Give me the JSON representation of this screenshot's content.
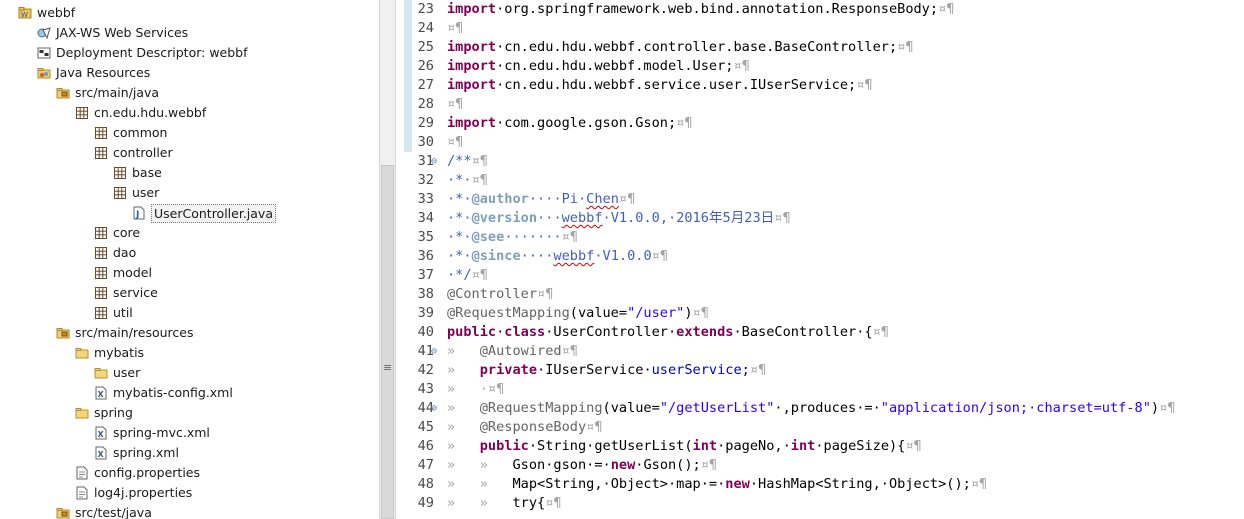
{
  "explorer": {
    "rows": [
      {
        "label": "webbf",
        "icon": "project-icon",
        "arrow": "▲"
      },
      {
        "label": "JAX-WS Web Services",
        "icon": "web-services-icon",
        "arrow": "▷"
      },
      {
        "label": "Deployment Descriptor: webbf",
        "icon": "descriptor-icon",
        "arrow": "▷"
      },
      {
        "label": "Java Resources",
        "icon": "java-resources-icon",
        "arrow": "▲"
      },
      {
        "label": "src/main/java",
        "icon": "source-folder-icon",
        "arrow": "▲"
      },
      {
        "label": "cn.edu.hdu.webbf",
        "icon": "package-icon",
        "arrow": "▲"
      },
      {
        "label": "common",
        "icon": "package-icon",
        "arrow": "▷"
      },
      {
        "label": "controller",
        "icon": "package-icon",
        "arrow": "▲"
      },
      {
        "label": "base",
        "icon": "package-icon",
        "arrow": "▷"
      },
      {
        "label": "user",
        "icon": "package-icon",
        "arrow": "▲"
      },
      {
        "label": "UserController.java",
        "icon": "java-file-icon",
        "arrow": "▷"
      },
      {
        "label": "core",
        "icon": "package-icon",
        "arrow": "▷"
      },
      {
        "label": "dao",
        "icon": "package-icon",
        "arrow": "▷"
      },
      {
        "label": "model",
        "icon": "package-icon",
        "arrow": "▷"
      },
      {
        "label": "service",
        "icon": "package-icon",
        "arrow": "▷"
      },
      {
        "label": "util",
        "icon": "package-icon",
        "arrow": ""
      },
      {
        "label": "src/main/resources",
        "icon": "source-folder-icon",
        "arrow": "▲"
      },
      {
        "label": "mybatis",
        "icon": "folder-icon",
        "arrow": "▲"
      },
      {
        "label": "user",
        "icon": "folder-icon",
        "arrow": "▷"
      },
      {
        "label": "mybatis-config.xml",
        "icon": "xml-file-icon",
        "arrow": ""
      },
      {
        "label": "spring",
        "icon": "folder-icon",
        "arrow": "▲"
      },
      {
        "label": "spring-mvc.xml",
        "icon": "xml-file-icon",
        "arrow": ""
      },
      {
        "label": "spring.xml",
        "icon": "xml-file-icon",
        "arrow": ""
      },
      {
        "label": "config.properties",
        "icon": "properties-file-icon",
        "arrow": ""
      },
      {
        "label": "log4j.properties",
        "icon": "properties-file-icon",
        "arrow": ""
      },
      {
        "label": "src/test/java",
        "icon": "source-folder-icon",
        "arrow": "▷"
      }
    ]
  },
  "editor": {
    "line_numbers": [
      "23",
      "24",
      "25",
      "26",
      "27",
      "28",
      "29",
      "30",
      "31",
      "32",
      "33",
      "34",
      "35",
      "36",
      "37",
      "38",
      "39",
      "40",
      "41",
      "42",
      "43",
      "44",
      "45",
      "46",
      "47",
      "48",
      "49"
    ],
    "lines": [
      [
        [
          "kw",
          "import"
        ],
        [
          "",
          "·org.springframework.web.bind.annotation.ResponseBody;"
        ],
        [
          "ws",
          "¤¶"
        ]
      ],
      [
        [
          "ws",
          "¤¶"
        ]
      ],
      [
        [
          "kw",
          "import"
        ],
        [
          "",
          "·cn.edu.hdu.webbf.controller.base.BaseController;"
        ],
        [
          "ws",
          "¤¶"
        ]
      ],
      [
        [
          "kw",
          "import"
        ],
        [
          "",
          "·cn.edu.hdu.webbf.model.User;"
        ],
        [
          "ws",
          "¤¶"
        ]
      ],
      [
        [
          "kw",
          "import"
        ],
        [
          "",
          "·cn.edu.hdu.webbf.service.user.IUserService;"
        ],
        [
          "ws",
          "¤¶"
        ]
      ],
      [
        [
          "ws",
          "¤¶"
        ]
      ],
      [
        [
          "kw",
          "import"
        ],
        [
          "",
          "·com.google.gson.Gson;"
        ],
        [
          "ws",
          "¤¶"
        ]
      ],
      [
        [
          "ws",
          "¤¶"
        ]
      ],
      [
        [
          "jd",
          "/**"
        ],
        [
          "ws",
          "¤¶"
        ]
      ],
      [
        [
          "jd",
          "·*·"
        ],
        [
          "ws",
          "¤¶"
        ]
      ],
      [
        [
          "jd",
          "·*·"
        ],
        [
          "jtag",
          "@author"
        ],
        [
          "jd",
          "····Pi·"
        ],
        [
          "jd sq",
          "Chen"
        ],
        [
          "ws",
          "¤¶"
        ]
      ],
      [
        [
          "jd",
          "·*·"
        ],
        [
          "jtag",
          "@version"
        ],
        [
          "jd",
          "···"
        ],
        [
          "jd sq",
          "webbf"
        ],
        [
          "jd",
          "·V1.0.0,·2016年5月23日"
        ],
        [
          "ws",
          "¤¶"
        ]
      ],
      [
        [
          "jd",
          "·*·"
        ],
        [
          "jtag",
          "@see"
        ],
        [
          "jd",
          "·······"
        ],
        [
          "ws",
          "¤¶"
        ]
      ],
      [
        [
          "jd",
          "·*·"
        ],
        [
          "jtag",
          "@since"
        ],
        [
          "jd",
          "····"
        ],
        [
          "jd sq",
          "webbf"
        ],
        [
          "jd",
          "·V1.0.0"
        ],
        [
          "ws",
          "¤¶"
        ]
      ],
      [
        [
          "jd",
          "·*/"
        ],
        [
          "ws",
          "¤¶"
        ]
      ],
      [
        [
          "ann",
          "@Controller"
        ],
        [
          "ws",
          "¤¶"
        ]
      ],
      [
        [
          "ann",
          "@RequestMapping"
        ],
        [
          "",
          "(value="
        ],
        [
          "str",
          "\"/user\""
        ],
        [
          "",
          ")"
        ],
        [
          "ws",
          "¤¶"
        ]
      ],
      [
        [
          "kw",
          "public"
        ],
        [
          "",
          "·"
        ],
        [
          "kw",
          "class"
        ],
        [
          "",
          "·UserController·"
        ],
        [
          "kw",
          "extends"
        ],
        [
          "",
          "·BaseController·{"
        ],
        [
          "ws",
          "¤¶"
        ]
      ],
      [
        [
          "ws",
          "»   "
        ],
        [
          "ann",
          "@Autowired"
        ],
        [
          "ws",
          "¤¶"
        ]
      ],
      [
        [
          "ws",
          "»   "
        ],
        [
          "kw",
          "private"
        ],
        [
          "",
          "·IUserService·"
        ],
        [
          "fld",
          "userService"
        ],
        [
          "",
          ";"
        ],
        [
          "ws",
          "¤¶"
        ]
      ],
      [
        [
          "ws",
          "»   ·¤¶"
        ]
      ],
      [
        [
          "ws",
          "»   "
        ],
        [
          "ann",
          "@RequestMapping"
        ],
        [
          "",
          "(value="
        ],
        [
          "str",
          "\"/getUserList\""
        ],
        [
          "",
          "·,produces·=·"
        ],
        [
          "str",
          "\"application/json;·charset=utf-8\""
        ],
        [
          "",
          ")"
        ],
        [
          "ws",
          "¤¶"
        ]
      ],
      [
        [
          "ws",
          "»   "
        ],
        [
          "ann",
          "@ResponseBody"
        ],
        [
          "ws",
          "¤¶"
        ]
      ],
      [
        [
          "ws",
          "»   "
        ],
        [
          "kw",
          "public"
        ],
        [
          "",
          "·String·getUserList("
        ],
        [
          "kw",
          "int"
        ],
        [
          "",
          "·pageNo,·"
        ],
        [
          "kw",
          "int"
        ],
        [
          "",
          "·pageSize){"
        ],
        [
          "ws",
          "¤¶"
        ]
      ],
      [
        [
          "ws",
          "»   »   "
        ],
        [
          "",
          "Gson·gson·=·"
        ],
        [
          "kw",
          "new"
        ],
        [
          "",
          "·Gson();"
        ],
        [
          "ws",
          "¤¶"
        ]
      ],
      [
        [
          "ws",
          "»   »   "
        ],
        [
          "",
          "Map<String,·Object>·map·=·"
        ],
        [
          "kw",
          "new"
        ],
        [
          "",
          "·HashMap<String,·Object>();"
        ],
        [
          "ws",
          "¤¶"
        ]
      ],
      [
        [
          "ws",
          "»   »   "
        ],
        [
          "",
          "try{"
        ],
        [
          "ws",
          "¤¶"
        ]
      ]
    ]
  },
  "colors": {
    "keyword": "#7f0055",
    "string": "#2a00ff",
    "annotation": "#646464",
    "javadoc": "#3f5fbf",
    "javadoc_tag": "#7f9fbf",
    "field": "#0000c0",
    "whitespace": "#a3a3a3"
  }
}
